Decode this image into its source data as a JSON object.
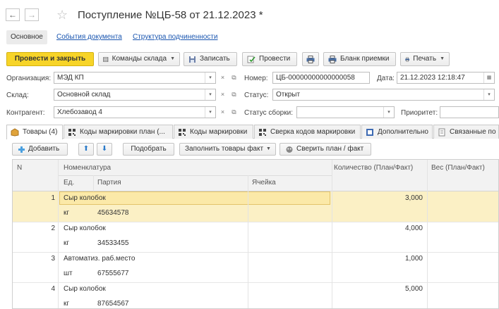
{
  "window": {
    "title": "Поступление №ЦБ-58 от 21.12.2023 *",
    "back_glyph": "←",
    "forward_glyph": "→",
    "star_glyph": "☆"
  },
  "nav_tabs": {
    "main": "Основное",
    "events": "События документа",
    "structure": "Структура подчиненности"
  },
  "toolbar": {
    "post_close": "Провести и закрыть",
    "warehouse_cmds": "Команды склада",
    "save": "Записать",
    "post": "Провести",
    "receipt_form": "Бланк приемки",
    "print": "Печать"
  },
  "form": {
    "org_label": "Организация:",
    "org_value": "МЭД КП",
    "number_label": "Номер:",
    "number_value": "ЦБ-00000000000000058",
    "date_label": "Дата:",
    "date_value": "21.12.2023 12:18:47",
    "warehouse_label": "Склад:",
    "warehouse_value": "Основной склад",
    "status_label": "Статус:",
    "status_value": "Открыт",
    "contractor_label": "Контрагент:",
    "contractor_value": "Хлебозавод 4",
    "assembly_label": "Статус сборки:",
    "assembly_value": "",
    "priority_label": "Приоритет:",
    "priority_value": "",
    "clear_glyph": "×",
    "open_glyph": "⧉",
    "dropdown_glyph": "▾",
    "calendar_glyph": "▦"
  },
  "section_tabs": [
    "Товары (4)",
    "Коды маркировки план (...",
    "Коды маркировки",
    "Сверка кодов маркировки",
    "Дополнительно",
    "Связанные по"
  ],
  "table_toolbar": {
    "add": "Добавить",
    "up_glyph": "⬆",
    "down_glyph": "⬇",
    "select": "Подобрать",
    "fill_fact": "Заполнить товары факт",
    "compare": "Сверить план / факт"
  },
  "table": {
    "headers": {
      "n": "N",
      "nomenclature": "Номенклатура",
      "qty": "Количество (План/Факт)",
      "weight": "Вес (План/Факт)",
      "unit": "Ед.",
      "batch": "Партия",
      "cell": "Ячейка"
    },
    "rows": [
      {
        "n": "1",
        "name": "Сыр колобок",
        "qty": "3,000",
        "unit": "кг",
        "batch": "45634578"
      },
      {
        "n": "2",
        "name": "Сыр колобок",
        "qty": "4,000",
        "unit": "кг",
        "batch": "34533455"
      },
      {
        "n": "3",
        "name": "Автоматиз. раб.место",
        "qty": "1,000",
        "unit": "шт",
        "batch": "67555677"
      },
      {
        "n": "4",
        "name": "Сыр колобок",
        "qty": "5,000",
        "unit": "кг",
        "batch": "87654567"
      }
    ]
  },
  "colors": {
    "primary_button": "#f7d428",
    "selected_row": "#fbf0c5",
    "link": "#1a56b0"
  }
}
